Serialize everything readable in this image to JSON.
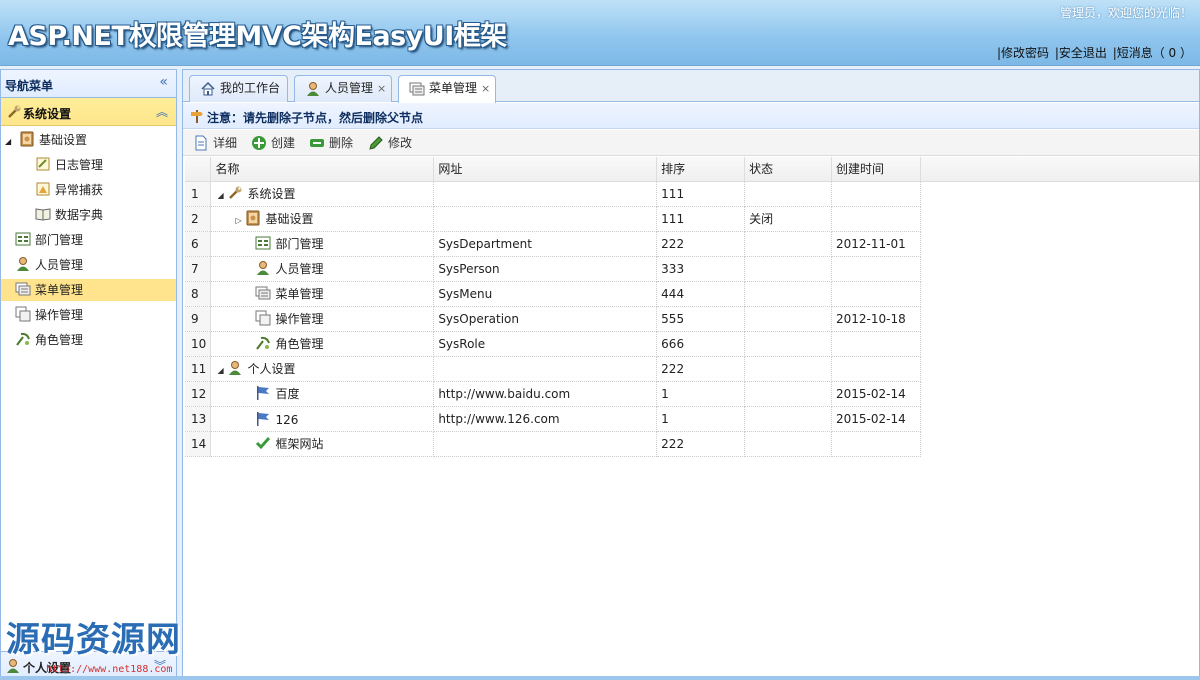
{
  "header": {
    "title": "ASP.NET权限管理MVC架构EasyUI框架",
    "welcome": "管理员，欢迎您的光临！",
    "links": [
      "|修改密码",
      "|安全退出",
      "|短消息（ 0 ）"
    ]
  },
  "sidebar": {
    "title": "导航菜单",
    "collapse_icon": "«",
    "section": "系统设置",
    "section_toggle": "︽",
    "items": [
      {
        "label": "基础设置",
        "icon": "book-icon"
      },
      {
        "label": "日志管理",
        "icon": "log-icon"
      },
      {
        "label": "异常捕获",
        "icon": "exception-icon"
      },
      {
        "label": "数据字典",
        "icon": "dictionary-icon"
      },
      {
        "label": "部门管理",
        "icon": "department-icon"
      },
      {
        "label": "人员管理",
        "icon": "person-icon"
      },
      {
        "label": "菜单管理",
        "icon": "menu-icon"
      },
      {
        "label": "操作管理",
        "icon": "operation-icon"
      },
      {
        "label": "角色管理",
        "icon": "role-icon"
      }
    ],
    "expander": "◢",
    "bottom_section": "个人设置",
    "bottom_toggle": "︾"
  },
  "tabs": [
    {
      "label": "我的工作台",
      "closable": false,
      "active": false
    },
    {
      "label": "人员管理",
      "closable": true,
      "active": false
    },
    {
      "label": "菜单管理",
      "closable": true,
      "active": true
    }
  ],
  "close_glyph": "×",
  "notice": "注意：请先删除子节点，然后删除父节点",
  "toolbar": {
    "detail": "详细",
    "create": "创建",
    "delete": "删除",
    "edit": "修改"
  },
  "grid": {
    "columns": [
      "名称",
      "网址",
      "排序",
      "状态",
      "创建时间"
    ],
    "rows": [
      {
        "no": "1",
        "arrow": "◢",
        "name": "系统设置",
        "url": "",
        "sort": "111",
        "status": "",
        "created": ""
      },
      {
        "no": "2",
        "arrow": "▷",
        "name": "基础设置",
        "url": "",
        "sort": "111",
        "status": "关闭",
        "created": ""
      },
      {
        "no": "6",
        "arrow": "",
        "name": "部门管理",
        "url": "SysDepartment",
        "sort": "222",
        "status": "",
        "created": "2012-11-01"
      },
      {
        "no": "7",
        "arrow": "",
        "name": "人员管理",
        "url": "SysPerson",
        "sort": "333",
        "status": "",
        "created": ""
      },
      {
        "no": "8",
        "arrow": "",
        "name": "菜单管理",
        "url": "SysMenu",
        "sort": "444",
        "status": "",
        "created": ""
      },
      {
        "no": "9",
        "arrow": "",
        "name": "操作管理",
        "url": "SysOperation",
        "sort": "555",
        "status": "",
        "created": "2012-10-18"
      },
      {
        "no": "10",
        "arrow": "",
        "name": "角色管理",
        "url": "SysRole",
        "sort": "666",
        "status": "",
        "created": ""
      },
      {
        "no": "11",
        "arrow": "◢",
        "name": "个人设置",
        "url": "",
        "sort": "222",
        "status": "",
        "created": ""
      },
      {
        "no": "12",
        "arrow": "",
        "name": "百度",
        "url": "http://www.baidu.com",
        "sort": "1",
        "status": "",
        "created": "2015-02-14"
      },
      {
        "no": "13",
        "arrow": "",
        "name": "126",
        "url": "http://www.126.com",
        "sort": "1",
        "status": "",
        "created": "2015-02-14"
      },
      {
        "no": "14",
        "arrow": "",
        "name": "框架网站",
        "url": "",
        "sort": "222",
        "status": "",
        "created": ""
      }
    ]
  },
  "watermark": "源码资源网",
  "watermark_url": "http://www.net188.com"
}
